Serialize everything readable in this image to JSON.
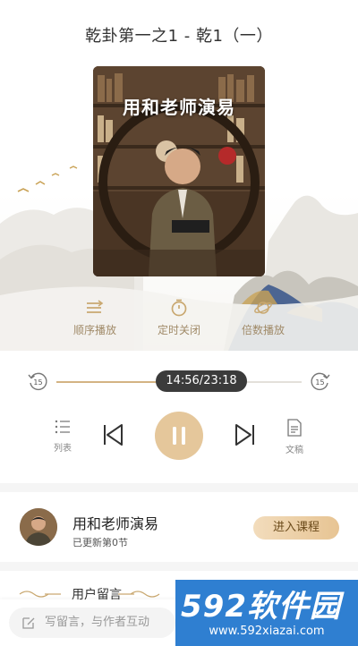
{
  "player": {
    "title": "乾卦第一之1 - 乾1（一）",
    "cover_title": "用和老师演易"
  },
  "controls": [
    {
      "label": "顺序播放",
      "icon": "sequential-play-icon"
    },
    {
      "label": "定时关闭",
      "icon": "timer-icon"
    },
    {
      "label": "倍数播放",
      "icon": "playback-speed-icon"
    }
  ],
  "progress": {
    "time": "14:56/23:18",
    "fraction": 0.641,
    "back_label": "15",
    "forward_label": "15"
  },
  "playback": {
    "list_label": "列表",
    "transcript_label": "文稿"
  },
  "author": {
    "name": "用和老师演易",
    "subtitle": "已更新第0节",
    "enter_label": "进入课程"
  },
  "comments": {
    "title": "用户留言",
    "placeholder": "写留言，与作者互动"
  },
  "watermark": {
    "title": "592软件园",
    "url": "www.592xiazai.com"
  },
  "colors": {
    "accent": "#e5c79b",
    "accent_text": "#a08a68",
    "pill": "#3b3b3b",
    "watermark": "#2f7fd1"
  }
}
